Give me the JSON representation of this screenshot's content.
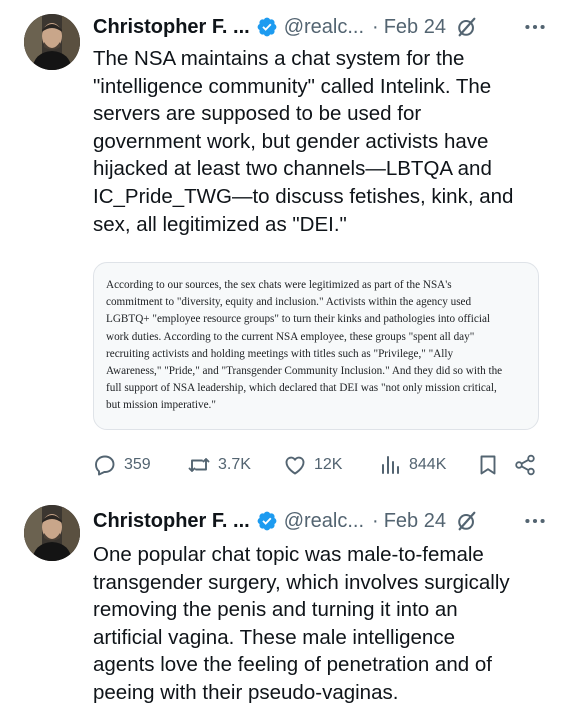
{
  "tweets": [
    {
      "author": {
        "name": "Christopher F. ...",
        "handle": "@realc...",
        "separator": "·",
        "date": "Feb 24"
      },
      "text": "The NSA maintains a chat system for the\n\"intelligence community\" called Intelink. The\nservers are supposed to be used for\ngovernment work, but gender activists have\nhijacked at least two channels—LBTQA and\nIC_Pride_TWG—to discuss fetishes, kink, and\nsex, all legitimized as \"DEI.\"",
      "quote": "According to our sources, the sex chats were legitimized as part of the NSA's\ncommitment to \"diversity, equity and inclusion.\" Activists within the agency used\nLGBTQ+ \"employee resource groups\" to turn their kinks and pathologies into official\nwork duties. According to the current NSA employee, these groups \"spent all day\"\nrecruiting activists and holding meetings with titles such as \"Privilege,\" \"Ally\nAwareness,\" \"Pride,\" and \"Transgender Community Inclusion.\" And they did so with the\nfull support of NSA leadership, which declared that DEI was \"not only mission critical,\nbut mission imperative.\"",
      "stats": {
        "replies": "359",
        "reposts": "3.7K",
        "likes": "12K",
        "views": "844K"
      }
    },
    {
      "author": {
        "name": "Christopher F. ...",
        "handle": "@realc...",
        "separator": "·",
        "date": "Feb 24"
      },
      "text": "One popular chat topic was male-to-female\ntransgender surgery, which involves surgically\nremoving the penis and turning it into an\nartificial vagina. These male intelligence\nagents love the feeling of penetration and of\npeeing with their pseudo-vaginas."
    }
  ],
  "icons": {
    "verified": "verified-badge-icon",
    "grok": "grok-icon",
    "more": "more-options-icon",
    "reply": "reply-icon",
    "repost": "repost-icon",
    "like": "like-icon",
    "views": "views-icon",
    "bookmark": "bookmark-icon",
    "share": "share-icon"
  },
  "colors": {
    "text": "#0f1419",
    "secondary": "#536471",
    "verified": "#1d9bf0",
    "quote_background": "#f7f9fa"
  }
}
